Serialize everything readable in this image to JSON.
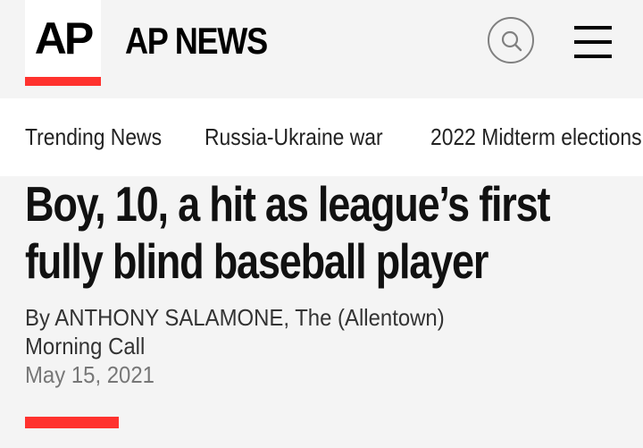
{
  "header": {
    "logo_text": "AP",
    "brand": "AP NEWS",
    "accent_color": "#ff322e",
    "search_icon": "search-icon",
    "menu_icon": "hamburger-menu-icon"
  },
  "nav": {
    "items": [
      {
        "label": "Trending News"
      },
      {
        "label": "Russia-Ukraine war"
      },
      {
        "label": "2022 Midterm elections"
      }
    ]
  },
  "article": {
    "headline": "Boy, 10, a hit as league’s first fully blind baseball player",
    "byline": "By ANTHONY SALAMONE, The (Allentown) Morning Call",
    "date": "May 15, 2021"
  }
}
